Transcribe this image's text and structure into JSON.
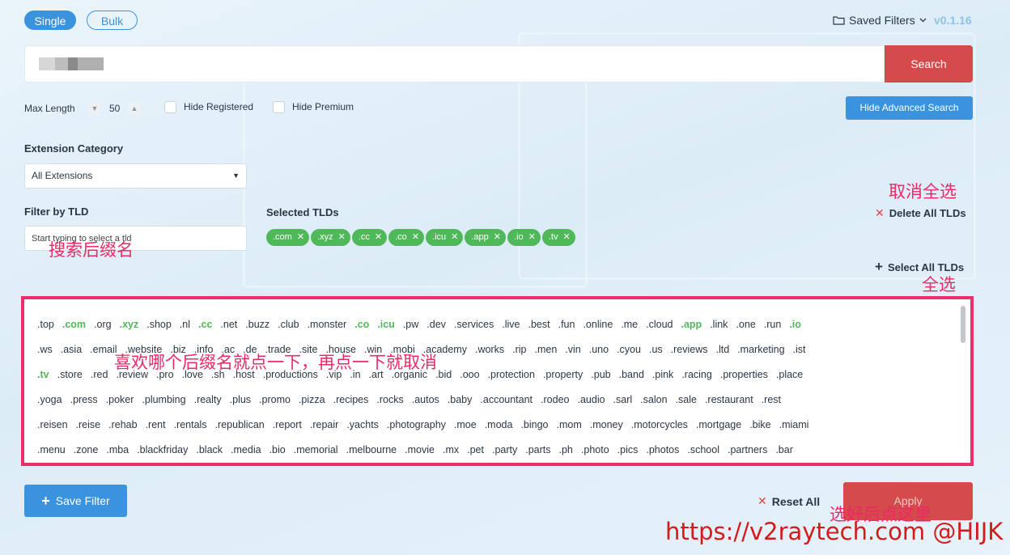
{
  "mode": {
    "single": "Single",
    "bulk": "Bulk"
  },
  "header": {
    "saved_filters": "Saved Filters",
    "version": "v0.1.16"
  },
  "search": {
    "button": "Search"
  },
  "options": {
    "max_length_label": "Max Length",
    "max_length_value": "50",
    "hide_registered": "Hide Registered",
    "hide_premium": "Hide Premium",
    "advanced_button": "Hide Advanced Search"
  },
  "extension_category": {
    "label": "Extension Category",
    "selected": "All Extensions"
  },
  "filter_tld": {
    "label": "Filter by TLD",
    "placeholder": "Start typing to select a tld"
  },
  "selected_tlds": {
    "label": "Selected TLDs",
    "chips": [
      ".com",
      ".xyz",
      ".cc",
      ".co",
      ".icu",
      ".app",
      ".io",
      ".tv"
    ]
  },
  "actions": {
    "delete_all": "Delete All TLDs",
    "select_all": "Select All TLDs"
  },
  "tld_rows": [
    [
      ".top",
      ".com",
      ".org",
      ".xyz",
      ".shop",
      ".nl",
      ".cc",
      ".net",
      ".buzz",
      ".club",
      ".monster",
      ".co",
      ".icu",
      ".pw",
      ".dev",
      ".services",
      ".live",
      ".best",
      ".fun",
      ".online",
      ".me",
      ".cloud",
      ".app",
      ".link",
      ".one",
      ".run",
      ".io"
    ],
    [
      ".ws",
      ".asia",
      ".email",
      ".website",
      ".biz",
      ".info",
      ".ac",
      ".de",
      ".trade",
      ".site",
      ".house",
      ".win",
      ".mobi",
      ".academy",
      ".works",
      ".rip",
      ".men",
      ".vin",
      ".uno",
      ".cyou",
      ".us",
      ".reviews",
      ".ltd",
      ".marketing",
      ".ist"
    ],
    [
      ".tv",
      ".store",
      ".red",
      ".review",
      ".pro",
      ".love",
      ".sh",
      ".host",
      ".productions",
      ".vip",
      ".in",
      ".art",
      ".organic",
      ".bid",
      ".ooo",
      ".protection",
      ".property",
      ".pub",
      ".band",
      ".pink",
      ".racing",
      ".properties",
      ".place"
    ],
    [
      ".yoga",
      ".press",
      ".poker",
      ".plumbing",
      ".realty",
      ".plus",
      ".promo",
      ".pizza",
      ".recipes",
      ".rocks",
      ".autos",
      ".baby",
      ".accountant",
      ".rodeo",
      ".audio",
      ".sarl",
      ".salon",
      ".sale",
      ".restaurant",
      ".rest"
    ],
    [
      ".reisen",
      ".reise",
      ".rehab",
      ".rent",
      ".rentals",
      ".republican",
      ".report",
      ".repair",
      ".yachts",
      ".photography",
      ".moe",
      ".moda",
      ".bingo",
      ".mom",
      ".money",
      ".motorcycles",
      ".mortgage",
      ".bike",
      ".miami"
    ],
    [
      ".menu",
      ".zone",
      ".mba",
      ".blackfriday",
      ".black",
      ".media",
      ".bio",
      ".memorial",
      ".melbourne",
      ".movie",
      ".mx",
      ".pet",
      ".party",
      ".parts",
      ".ph",
      ".photo",
      ".pics",
      ".photos",
      ".school",
      ".partners",
      ".bar"
    ]
  ],
  "selected_set": [
    ".com",
    ".xyz",
    ".cc",
    ".co",
    ".icu",
    ".app",
    ".io",
    ".tv"
  ],
  "footer": {
    "save_filter": "Save Filter",
    "reset_all": "Reset All",
    "apply": "Apply"
  },
  "annotations": {
    "cancel_all": "取消全选",
    "search_suffix": "搜索后缀名",
    "select_all": "全选",
    "click_toggle": "喜欢哪个后缀名就点一下，再点一下就取消",
    "click_here": "选好后点这里"
  },
  "watermark": "https://v2raytech.com @HIJK",
  "colors": {
    "primary": "#3b93dd",
    "danger": "#d54a4a",
    "success": "#4fb858",
    "annotation": "#ea2a66"
  }
}
